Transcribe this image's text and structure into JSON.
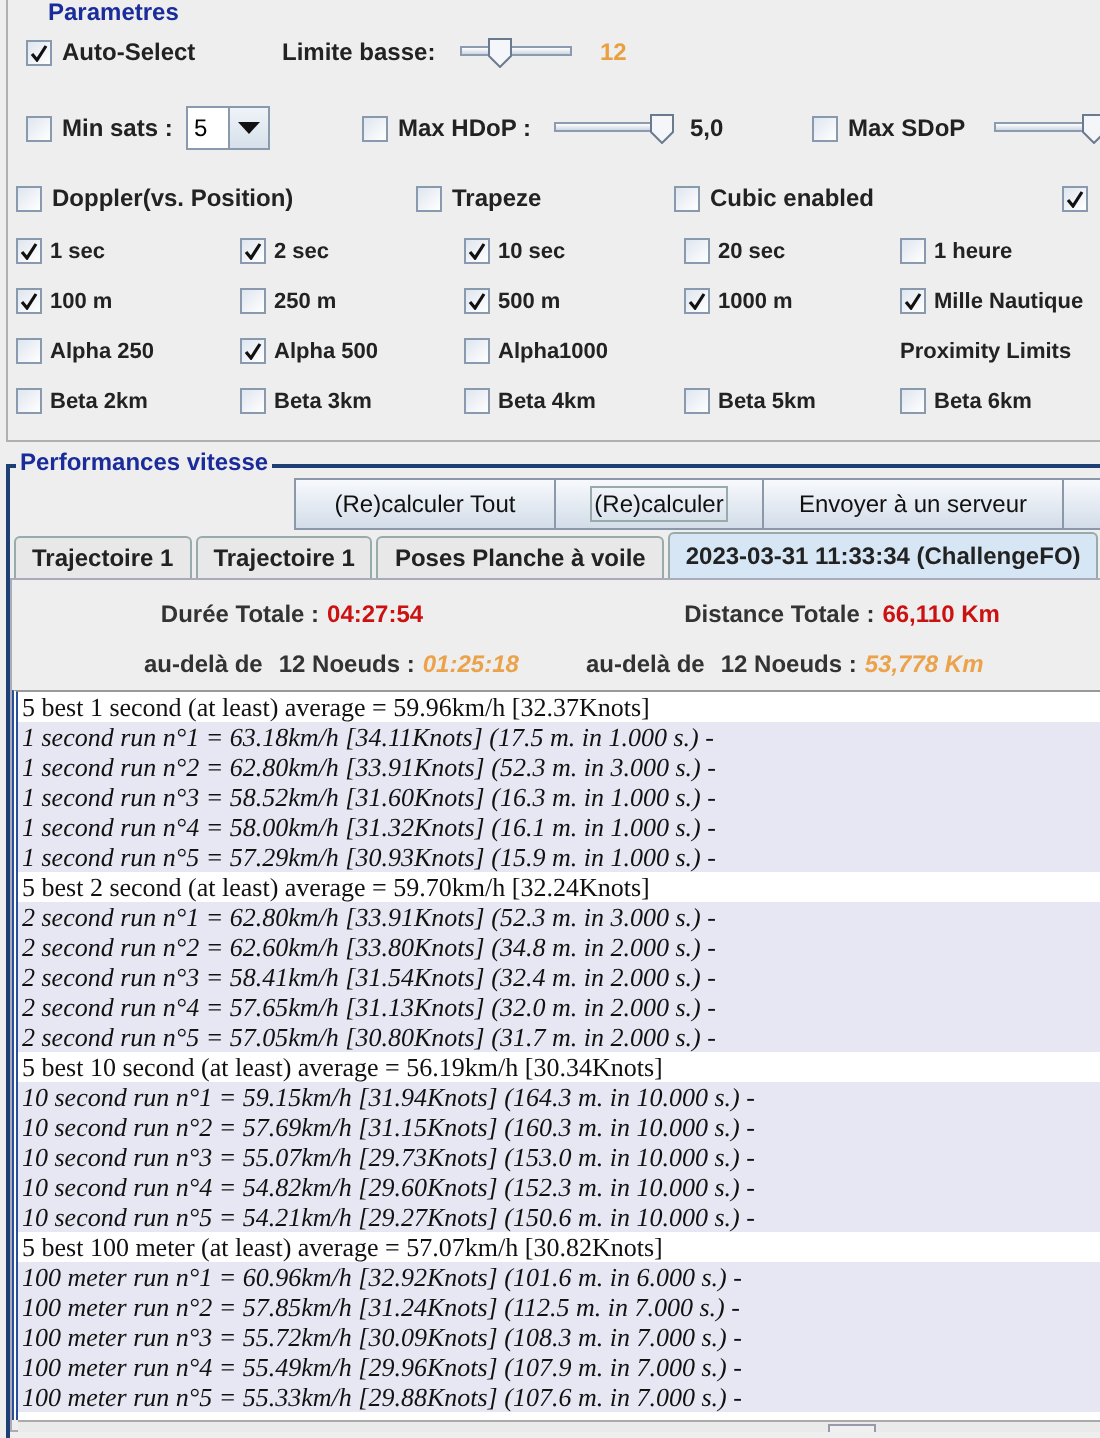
{
  "parameters": {
    "title": "Parametres",
    "row_1": [
      {
        "kind": "checkbox",
        "label": "Auto-Select",
        "checked": true
      },
      {
        "kind": "label",
        "label": "Limite basse:"
      },
      {
        "kind": "slider",
        "level": 0.35
      },
      {
        "kind": "reading",
        "text": "12",
        "color": "#e8a040"
      }
    ],
    "row_2": [
      {
        "kind": "checkbox",
        "label": "Min sats :",
        "checked": false
      },
      {
        "kind": "combo",
        "value": "5"
      },
      {
        "kind": "checkbox",
        "label": "Max HDoP :",
        "checked": false
      },
      {
        "kind": "slider",
        "level": 0.9
      },
      {
        "kind": "reading",
        "text": "5,0",
        "color": "#222222"
      },
      {
        "kind": "checkbox",
        "label": "Max SDoP",
        "checked": false
      },
      {
        "kind": "slider",
        "level": 0.9
      }
    ],
    "row_3": [
      {
        "kind": "checkbox",
        "label": "Doppler(vs. Position)",
        "checked": false
      },
      {
        "kind": "checkbox",
        "label": "Trapeze",
        "checked": false
      },
      {
        "kind": "checkbox",
        "label": "Cubic enabled",
        "checked": false
      },
      {
        "kind": "checkbox",
        "checked": true
      }
    ],
    "grid": [
      [
        {
          "kind": "checkbox",
          "label": "1 sec",
          "checked": true
        },
        {
          "kind": "checkbox",
          "label": "2 sec",
          "checked": true
        },
        {
          "kind": "checkbox",
          "label": "10 sec",
          "checked": true
        },
        {
          "kind": "checkbox",
          "label": "20 sec",
          "checked": false
        },
        {
          "kind": "checkbox",
          "label": "1 heure",
          "checked": false
        }
      ],
      [
        {
          "kind": "checkbox",
          "label": "100 m",
          "checked": true
        },
        {
          "kind": "checkbox",
          "label": "250 m",
          "checked": false
        },
        {
          "kind": "checkbox",
          "label": "500 m",
          "checked": true
        },
        {
          "kind": "checkbox",
          "label": "1000 m",
          "checked": true
        },
        {
          "kind": "checkbox",
          "label": "Mille Nautique",
          "checked": true
        }
      ],
      [
        {
          "kind": "checkbox",
          "label": "Alpha 250",
          "checked": false
        },
        {
          "kind": "checkbox",
          "label": "Alpha 500",
          "checked": true
        },
        {
          "kind": "checkbox",
          "label": "Alpha1000",
          "checked": false
        },
        {
          "kind": "blank"
        },
        {
          "kind": "label",
          "label": "Proximity Limits"
        }
      ],
      [
        {
          "kind": "checkbox",
          "label": "Beta 2km",
          "checked": false
        },
        {
          "kind": "checkbox",
          "label": "Beta 3km",
          "checked": false
        },
        {
          "kind": "checkbox",
          "label": "Beta 4km",
          "checked": false
        },
        {
          "kind": "checkbox",
          "label": "Beta 5km",
          "checked": false
        },
        {
          "kind": "checkbox",
          "label": "Beta 6km",
          "checked": false
        }
      ]
    ]
  },
  "performances": {
    "title": "Performances vitesse",
    "buttons": [
      {
        "label": "(Re)calculer Tout",
        "focused": false
      },
      {
        "label": "(Re)calculer",
        "focused": true
      },
      {
        "label": "Envoyer à un serveur",
        "focused": false
      },
      {
        "focused": false
      }
    ],
    "tabs": [
      {
        "label": "Trajectoire 1",
        "selected": false
      },
      {
        "label": "Trajectoire 1",
        "selected": false
      },
      {
        "label": "Poses Planche à voile",
        "selected": false
      },
      {
        "label": "2023-03-31 11:33:34 (ChallengeFO)",
        "selected": true
      }
    ],
    "stats": [
      {
        "kind": "total",
        "label": "Durée Totale :",
        "value": "04:27:54"
      },
      {
        "kind": "total",
        "label": "Distance Totale :",
        "value": "66,110 Km"
      },
      {
        "kind": "beyond",
        "label": "au-delà de",
        "threshold": "12 Noeuds :",
        "value": "01:25:18"
      },
      {
        "kind": "beyond",
        "label": "au-delà de",
        "threshold": "12 Noeuds :",
        "value": "53,778 Km"
      }
    ],
    "results": [
      {
        "kind": "summary",
        "text": "5 best 1 second (at least) average = 59.96km/h [32.37Knots]"
      },
      {
        "kind": "run",
        "text": "1 second run n°1 = 63.18km/h [34.11Knots] (17.5 m. in 1.000 s.) -"
      },
      {
        "kind": "run",
        "text": "1 second run n°2 = 62.80km/h [33.91Knots] (52.3 m. in 3.000 s.) -"
      },
      {
        "kind": "run",
        "text": "1 second run n°3 = 58.52km/h [31.60Knots] (16.3 m. in 1.000 s.) -"
      },
      {
        "kind": "run",
        "text": "1 second run n°4 = 58.00km/h [31.32Knots] (16.1 m. in 1.000 s.) -"
      },
      {
        "kind": "run",
        "text": "1 second run n°5 = 57.29km/h [30.93Knots] (15.9 m. in 1.000 s.) -"
      },
      {
        "kind": "summary",
        "text": "5 best 2 second (at least) average = 59.70km/h [32.24Knots]"
      },
      {
        "kind": "run",
        "text": "2 second run n°1 = 62.80km/h [33.91Knots] (52.3 m. in 3.000 s.) -"
      },
      {
        "kind": "run",
        "text": "2 second run n°2 = 62.60km/h [33.80Knots] (34.8 m. in 2.000 s.) -"
      },
      {
        "kind": "run",
        "text": "2 second run n°3 = 58.41km/h [31.54Knots] (32.4 m. in 2.000 s.) -"
      },
      {
        "kind": "run",
        "text": "2 second run n°4 = 57.65km/h [31.13Knots] (32.0 m. in 2.000 s.) -"
      },
      {
        "kind": "run",
        "text": "2 second run n°5 = 57.05km/h [30.80Knots] (31.7 m. in 2.000 s.) -"
      },
      {
        "kind": "summary",
        "text": "5 best 10 second (at least) average = 56.19km/h [30.34Knots]"
      },
      {
        "kind": "run",
        "text": "10 second run n°1 = 59.15km/h [31.94Knots] (164.3 m. in 10.000 s.) -"
      },
      {
        "kind": "run",
        "text": "10 second run n°2 = 57.69km/h [31.15Knots] (160.3 m. in 10.000 s.) -"
      },
      {
        "kind": "run",
        "text": "10 second run n°3 = 55.07km/h [29.73Knots] (153.0 m. in 10.000 s.) -"
      },
      {
        "kind": "run",
        "text": "10 second run n°4 = 54.82km/h [29.60Knots] (152.3 m. in 10.000 s.) -"
      },
      {
        "kind": "run",
        "text": "10 second run n°5 = 54.21km/h [29.27Knots] (150.6 m. in 10.000 s.) -"
      },
      {
        "kind": "summary",
        "text": "5 best 100 meter (at least) average = 57.07km/h [30.82Knots]"
      },
      {
        "kind": "run",
        "text": "100 meter run n°1 = 60.96km/h [32.92Knots] (101.6 m. in 6.000 s.) -"
      },
      {
        "kind": "run",
        "text": "100 meter run n°2 = 57.85km/h [31.24Knots] (112.5 m. in 7.000 s.) -"
      },
      {
        "kind": "run",
        "text": "100 meter run n°3 = 55.72km/h [30.09Knots] (108.3 m. in 7.000 s.) -"
      },
      {
        "kind": "run",
        "text": "100 meter run n°4 = 55.49km/h [29.96Knots] (107.9 m. in 7.000 s.) -"
      },
      {
        "kind": "run",
        "text": "100 meter run n°5 = 55.33km/h [29.88Knots] (107.6 m. in 7.000 s.) -"
      }
    ]
  }
}
